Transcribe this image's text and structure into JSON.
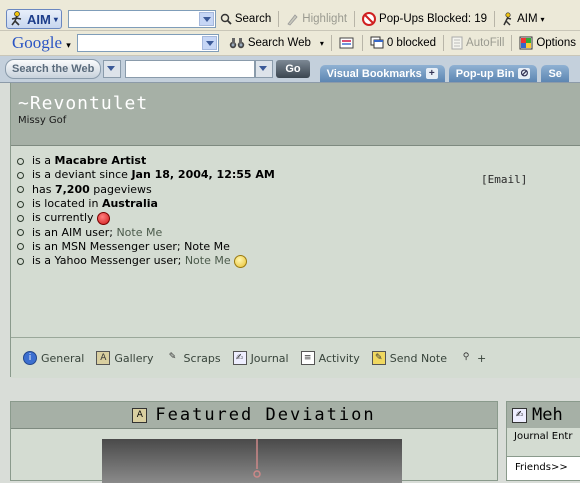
{
  "aim_toolbar": {
    "aim_label": "AIM",
    "search_label": "Search",
    "highlight_label": "Highlight",
    "popups_label": "Pop-Ups Blocked: 19",
    "aim_menu_label": "AIM"
  },
  "google_toolbar": {
    "logo": "Google",
    "search_web_label": "Search Web",
    "blocked_label": "0 blocked",
    "autofill_label": "AutoFill",
    "options_label": "Options"
  },
  "bookmark_toolbar": {
    "search_the_web_label": "Search the Web",
    "go_label": "Go",
    "visual_bookmarks_label": "Visual Bookmarks",
    "popup_bin_label": "Pop-up Bin",
    "cut_tab_label": "Se"
  },
  "profile": {
    "username": "~Revontulet",
    "user_title": "Missy Gof",
    "email_link": "[Email]",
    "facts": {
      "f1_prefix": "is a ",
      "f1_value": "Macabre Artist",
      "f2_prefix": "is a deviant since ",
      "f2_value": "Jan 18, 2004, 12:55 AM",
      "f3_prefix": "has ",
      "f3_value": "7,200",
      "f3_suffix": " pageviews",
      "f4_prefix": "is located in ",
      "f4_value": "Australia",
      "f5_prefix": "is currently",
      "f6_prefix": "is an AIM user; ",
      "f6_link": "Note Me",
      "f7_text": "is an MSN Messenger user; Note Me",
      "f8_prefix": "is a Yahoo Messenger user; ",
      "f8_link": "Note Me"
    },
    "tabs": [
      "General",
      "Gallery",
      "Scraps",
      "Journal",
      "Activity",
      "Send Note",
      "+"
    ]
  },
  "featured": {
    "title": "Featured Deviation"
  },
  "journal": {
    "title": "Meh",
    "subtitle": "Journal Entr",
    "friends_label": "Friends>>"
  },
  "colors": {
    "panel_header": "#a6b0a6",
    "panel_body": "#d4dcd2",
    "toolbar": "#ece9d8",
    "tab_blue": "#5d86b2"
  }
}
